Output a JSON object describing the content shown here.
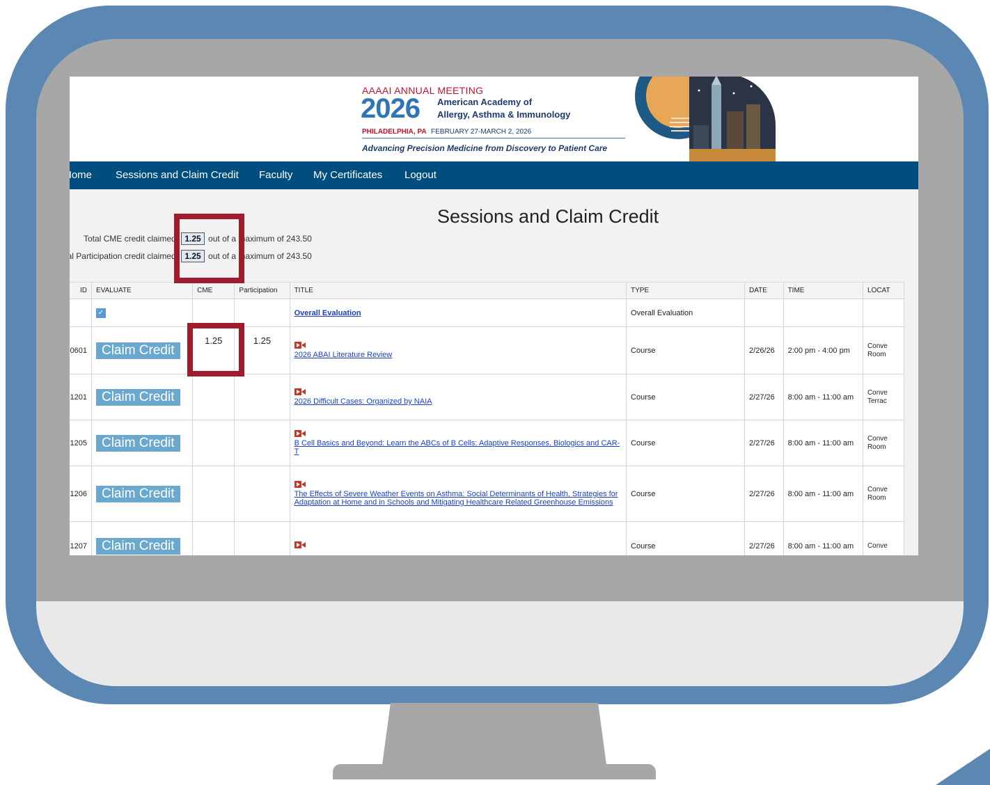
{
  "banner": {
    "annual": "AAAAI ANNUAL MEETING",
    "year": "2026",
    "org_line1": "American Academy of",
    "org_line2": "Allergy, Asthma & Immunology",
    "city": "PHILADELPHIA, PA",
    "dates": "FEBRUARY 27-MARCH 2, 2026",
    "tagline": "Advancing Precision Medicine from Discovery to Patient Care"
  },
  "nav": {
    "items": [
      {
        "label": "Home"
      },
      {
        "label": "Sessions and Claim Credit"
      },
      {
        "label": "Faculty"
      },
      {
        "label": "My Certificates"
      },
      {
        "label": "Logout"
      }
    ]
  },
  "page_title": "Sessions and Claim Credit",
  "credits": {
    "cme_label": "Total CME credit claimed:",
    "cme_value": "1.25",
    "cme_suffix": "out of a maximum of 243.50",
    "part_label": "Total Participation credit claimed:",
    "part_value": "1.25",
    "part_suffix": "out of a maximum of 243.50"
  },
  "table": {
    "headers": {
      "id": "ID",
      "evaluate": "EVALUATE",
      "cme": "CME",
      "participation": "Participation",
      "title": "TITLE",
      "type": "TYPE",
      "date": "DATE",
      "time": "TIME",
      "location": "LOCAT"
    },
    "overall": {
      "title": "Overall Evaluation",
      "type": "Overall Evaluation"
    },
    "claim_label": "Claim Credit",
    "rows": [
      {
        "id": "0601",
        "cme": "1.25",
        "participation": "1.25",
        "title": "2026 ABAI Literature Review",
        "type": "Course",
        "date": "2/26/26",
        "time": "2:00 pm - 4:00 pm",
        "loc1": "Conve",
        "loc2": "Room"
      },
      {
        "id": "1201",
        "cme": "",
        "participation": "",
        "title": "2026 Difficult Cases: Organized by NAIA",
        "type": "Course",
        "date": "2/27/26",
        "time": "8:00 am - 11:00 am",
        "loc1": "Conve",
        "loc2": "Terrac"
      },
      {
        "id": "1205",
        "cme": "",
        "participation": "",
        "title": "B Cell Basics and Beyond: Learn the ABCs of B Cells: Adaptive Responses, Biologics and CAR-T",
        "type": "Course",
        "date": "2/27/26",
        "time": "8:00 am - 11:00 am",
        "loc1": "Conve",
        "loc2": "Room"
      },
      {
        "id": "1206",
        "cme": "",
        "participation": "",
        "title": "The Effects of Severe Weather Events on Asthma: Social Determinants of Health, Strategies for Adaptation at Home and in Schools and Mitigating Healthcare Related Greenhouse Emissions",
        "type": "Course",
        "date": "2/27/26",
        "time": "8:00 am - 11:00 am",
        "loc1": "Conve",
        "loc2": "Room"
      },
      {
        "id": "1207",
        "cme": "",
        "participation": "",
        "title": "",
        "type": "Course",
        "date": "2/27/26",
        "time": "8:00 am - 11:00 am",
        "loc1": "Conve",
        "loc2": ""
      }
    ]
  },
  "colors": {
    "frame": "#5b87b3",
    "nav": "#004d80",
    "highlight": "#a01c2c",
    "claim_button": "#6aa8d0"
  }
}
